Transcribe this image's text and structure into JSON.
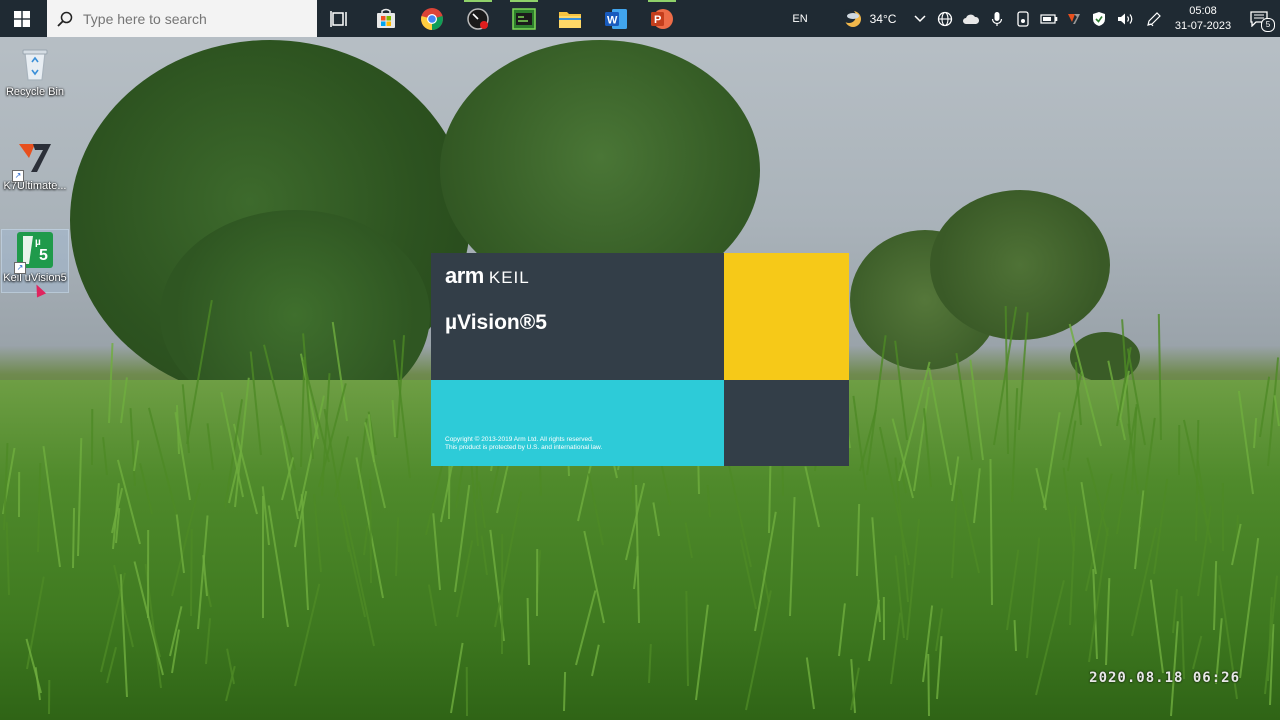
{
  "taskbar": {
    "search_placeholder": "Type here to search",
    "apps": [
      {
        "name": "task-view",
        "icon": "task-view-icon"
      },
      {
        "name": "microsoft-store",
        "icon": "store-icon"
      },
      {
        "name": "google-chrome",
        "icon": "chrome-icon"
      },
      {
        "name": "gauge-app",
        "icon": "gauge-icon",
        "active": true
      },
      {
        "name": "terminal-app",
        "icon": "terminal-icon",
        "active": true
      },
      {
        "name": "file-explorer",
        "icon": "folder-icon"
      },
      {
        "name": "microsoft-word",
        "icon": "word-icon",
        "letter": "W"
      },
      {
        "name": "microsoft-powerpoint",
        "icon": "powerpoint-icon",
        "letter": "P",
        "active": true
      }
    ],
    "tray": {
      "language": "EN",
      "temperature": "34°C",
      "time": "05:08",
      "date": "31-07-2023",
      "notification_count": "5"
    }
  },
  "desktop": {
    "icons": [
      {
        "label": "Recycle Bin",
        "icon": "recycle-bin-icon"
      },
      {
        "label": "K7Ultimate...",
        "icon": "k7-antivirus-icon"
      },
      {
        "label": "Keil uVision5",
        "icon": "keil-uvision-icon",
        "selected": true
      }
    ]
  },
  "splash": {
    "brand": "arm",
    "sub_brand": "KEIL",
    "product": "µVision®5",
    "copyright_line1": "Copyright © 2013-2019 Arm Ltd. All rights reserved.",
    "copyright_line2": "This product is protected by U.S. and international law."
  },
  "wallpaper": {
    "date_stamp": "2020.08.18 06:26"
  },
  "colors": {
    "taskbar_bg": "#1f2a33",
    "splash_dark": "#333e48",
    "splash_yellow": "#f6c918",
    "splash_cyan": "#2dcbd8"
  }
}
